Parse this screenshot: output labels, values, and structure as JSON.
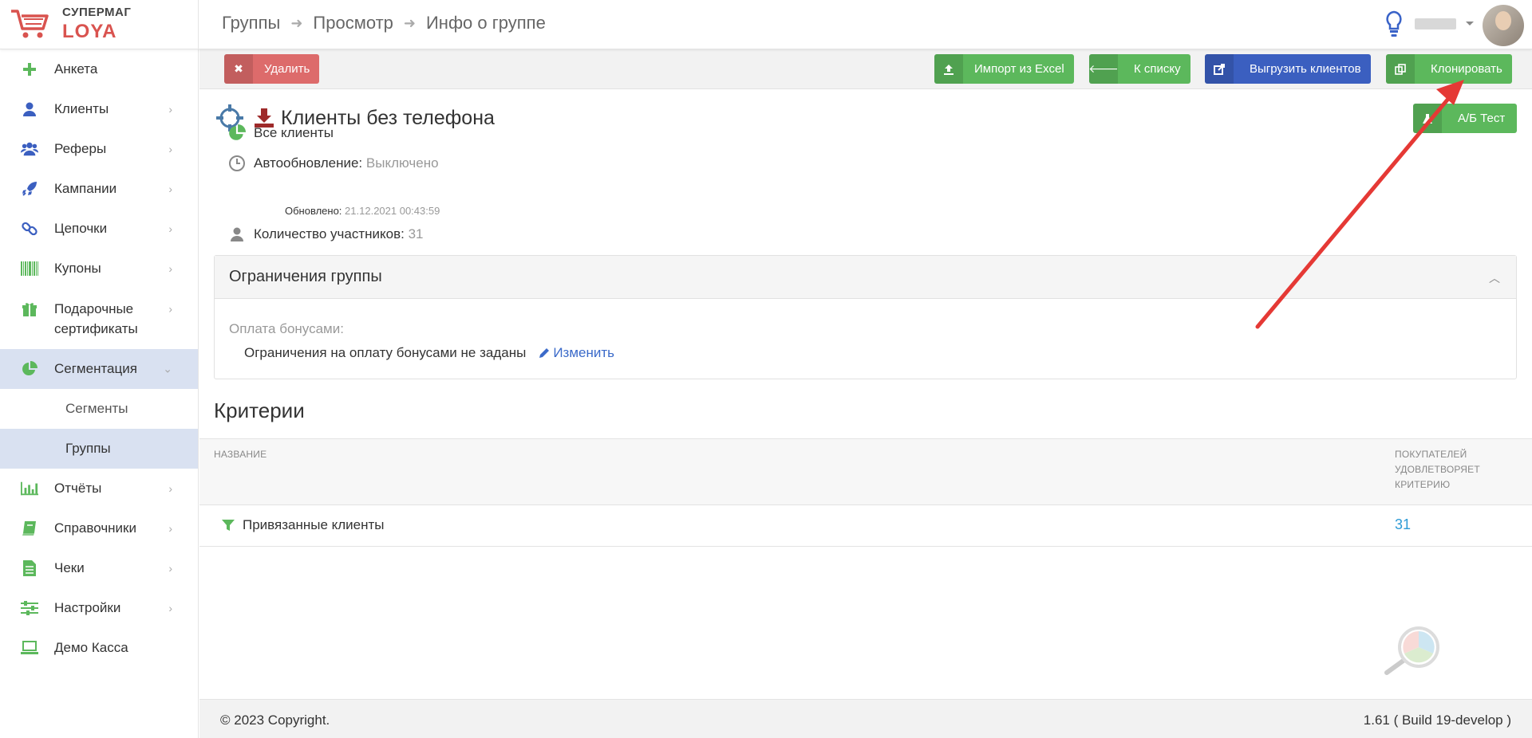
{
  "logo": {
    "line1": "СУПЕРМАГ",
    "line2": "LOYA"
  },
  "breadcrumb": [
    "Группы",
    "Просмотр",
    "Инфо о группе"
  ],
  "sidebar": {
    "items": [
      {
        "label": "Анкета",
        "icon": "plus-icon"
      },
      {
        "label": "Клиенты",
        "icon": "user-icon"
      },
      {
        "label": "Реферы",
        "icon": "users-icon"
      },
      {
        "label": "Кампании",
        "icon": "rocket-icon"
      },
      {
        "label": "Цепочки",
        "icon": "link-icon"
      },
      {
        "label": "Купоны",
        "icon": "barcode-icon"
      },
      {
        "label": "Подарочные сертификаты",
        "line1": "Подарочные",
        "line2": "сертификаты",
        "icon": "gift-icon"
      },
      {
        "label": "Сегментация",
        "icon": "pie-chart-icon"
      },
      {
        "label": "Сегменты"
      },
      {
        "label": "Группы"
      },
      {
        "label": "Отчёты",
        "icon": "bar-chart-icon"
      },
      {
        "label": "Справочники",
        "icon": "book-icon"
      },
      {
        "label": "Чеки",
        "icon": "receipt-icon"
      },
      {
        "label": "Настройки",
        "icon": "sliders-icon"
      },
      {
        "label": "Демо Касса",
        "icon": "laptop-icon"
      }
    ]
  },
  "toolbar": {
    "delete": "Удалить",
    "import": "Импорт из Excel",
    "to_list": "К списку",
    "export": "Выгрузить клиентов",
    "clone": "Клонировать"
  },
  "group": {
    "title": "Клиенты без телефона",
    "ab_test": "А/Б Тест",
    "all_clients": "Все клиенты",
    "autoupdate_label": "Автообновление:",
    "autoupdate_value": "Выключено",
    "updated_label": "Обновлено:",
    "updated_value": "21.12.2021 00:43:59",
    "members_label": "Количество участников:",
    "members_value": "31"
  },
  "restrictions": {
    "title": "Ограничения группы",
    "pay_label": "Оплата бонусами:",
    "pay_value": "Ограничения на оплату бонусами не заданы",
    "edit": "Изменить"
  },
  "criteria": {
    "title": "Критерии",
    "col_name": "НАЗВАНИЕ",
    "col_count_1": "ПОКУПАТЕЛЕЙ",
    "col_count_2": "УДОВЛЕТВОРЯЕТ",
    "col_count_3": "КРИТЕРИЮ",
    "rows": [
      {
        "name": "Привязанные клиенты",
        "count": "31"
      }
    ]
  },
  "footer": {
    "copyright": "© 2023 Copyright.",
    "version": "1.61 ( Build 19-develop )"
  },
  "colors": {
    "green": "#5cb85c",
    "red": "#dd6b6b",
    "blue": "#3b5fc0",
    "active_nav": "#d9e1f1",
    "link": "#2e9bd6",
    "arrow": "#e53935"
  }
}
